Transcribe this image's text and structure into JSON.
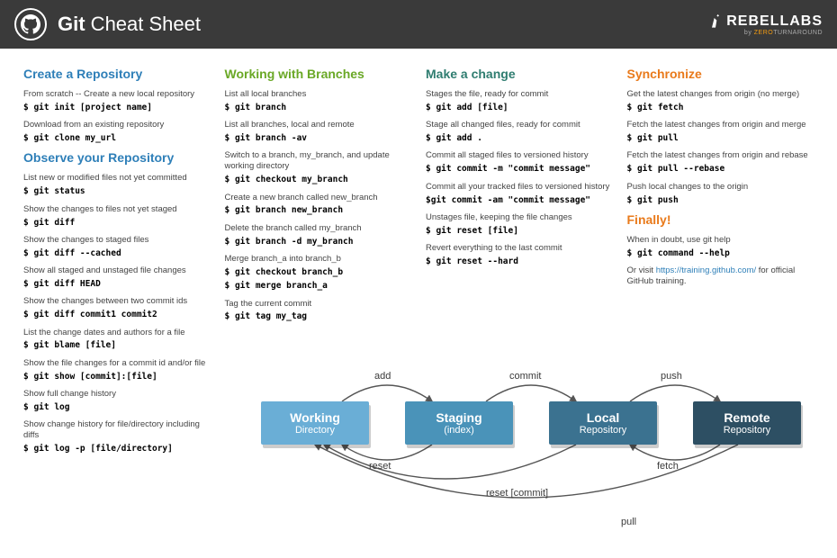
{
  "header": {
    "title_bold": "Git",
    "title_rest": " Cheat Sheet",
    "brand_top": "REBELLABS",
    "brand_sub_prefix": "by ",
    "brand_sub_highlight": "ZERO",
    "brand_sub_suffix": "TURNAROUND"
  },
  "col1": {
    "s1": {
      "title": "Create a Repository",
      "e": [
        {
          "d": "From scratch -- Create a new local repository",
          "c": "$ git init [project name]"
        },
        {
          "d": "Download from an existing repository",
          "c": "$ git clone my_url"
        }
      ]
    },
    "s2": {
      "title": "Observe your Repository",
      "e": [
        {
          "d": "List new or modified files not yet committed",
          "c": "$ git status"
        },
        {
          "d": "Show the changes to files not yet staged",
          "c": "$ git diff"
        },
        {
          "d": "Show the changes to staged files",
          "c": "$ git diff --cached"
        },
        {
          "d": "Show all staged and unstaged file changes",
          "c": "$ git diff HEAD"
        },
        {
          "d": "Show the changes between two commit ids",
          "c": "$ git diff commit1 commit2"
        },
        {
          "d": "List the change dates and authors for a file",
          "c": "$ git blame [file]"
        },
        {
          "d": "Show the file changes for a commit id and/or file",
          "c": "$ git show [commit]:[file]"
        },
        {
          "d": "Show full change history",
          "c": "$ git log"
        },
        {
          "d": "Show change history for file/directory including diffs",
          "c": "$ git log -p [file/directory]"
        }
      ]
    }
  },
  "col2": {
    "s1": {
      "title": "Working with Branches",
      "e": [
        {
          "d": "List all local branches",
          "c": "$ git branch"
        },
        {
          "d": "List all branches, local and remote",
          "c": "$ git branch -av"
        },
        {
          "d": "Switch to a branch, my_branch, and update working directory",
          "c": "$ git checkout my_branch"
        },
        {
          "d": "Create a new branch called new_branch",
          "c": "$ git branch new_branch"
        },
        {
          "d": "Delete the branch called my_branch",
          "c": "$ git branch -d my_branch"
        },
        {
          "d": "Merge branch_a into branch_b",
          "c": "$ git checkout branch_b",
          "c2": "$ git merge branch_a"
        },
        {
          "d": "Tag the current commit",
          "c": "$ git tag my_tag"
        }
      ]
    }
  },
  "col3": {
    "s1": {
      "title": "Make a change",
      "e": [
        {
          "d": "Stages the file, ready for commit",
          "c": "$ git add [file]"
        },
        {
          "d": "Stage all changed files, ready for commit",
          "c": "$ git add ."
        },
        {
          "d": "Commit all staged files to versioned history",
          "c": "$ git commit -m \"commit message\""
        },
        {
          "d": "Commit all your tracked files to versioned history",
          "c": "$git commit -am \"commit message\""
        },
        {
          "d": "Unstages file, keeping the file changes",
          "c": "$ git reset [file]"
        },
        {
          "d": "Revert everything to the last commit",
          "c": "$ git reset --hard"
        }
      ]
    }
  },
  "col4": {
    "s1": {
      "title": "Synchronize",
      "e": [
        {
          "d": "Get the latest changes from origin (no merge)",
          "c": "$ git fetch"
        },
        {
          "d": "Fetch the latest changes from origin and merge",
          "c": "$ git pull"
        },
        {
          "d": "Fetch the latest changes from origin and rebase",
          "c": "$ git pull --rebase"
        },
        {
          "d": "Push local changes to the origin",
          "c": "$ git push"
        }
      ]
    },
    "s2": {
      "title": "Finally!",
      "e": [
        {
          "d": "When in doubt, use git help",
          "c": "$ git command --help"
        }
      ],
      "note_prefix": "Or visit ",
      "note_link": "https://training.github.com/",
      "note_suffix": " for official GitHub training."
    }
  },
  "diagram": {
    "b1": {
      "t1": "Working",
      "t2": "Directory"
    },
    "b2": {
      "t1": "Staging",
      "t2": "(index)"
    },
    "b3": {
      "t1": "Local",
      "t2": "Repository"
    },
    "b4": {
      "t1": "Remote",
      "t2": "Repository"
    },
    "labels": {
      "add": "add",
      "commit": "commit",
      "push": "push",
      "reset": "reset",
      "fetch": "fetch",
      "reset_commit": "reset [commit]",
      "pull": "pull"
    }
  }
}
